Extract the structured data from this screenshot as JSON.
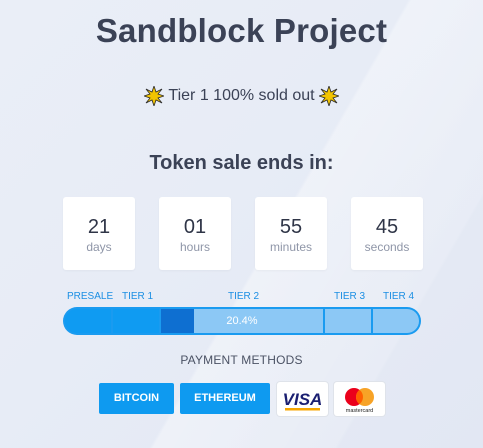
{
  "header": {
    "title": "Sandblock Project",
    "soldout_text": "Tier 1 100% sold out"
  },
  "countdown": {
    "heading": "Token sale ends in:",
    "items": [
      {
        "value": "21",
        "unit": "days"
      },
      {
        "value": "01",
        "unit": "hours"
      },
      {
        "value": "55",
        "unit": "minutes"
      },
      {
        "value": "45",
        "unit": "seconds"
      }
    ]
  },
  "progress": {
    "tiers": [
      "PRESALE",
      "TIER 1",
      "TIER 2",
      "TIER 3",
      "TIER 4"
    ],
    "tier2_label": "20.4%",
    "tier2_fraction": 0.204
  },
  "payment": {
    "heading": "PAYMENT METHODS",
    "buttons": [
      "BITCOIN",
      "ETHEREUM"
    ],
    "cards": [
      {
        "name": "VISA",
        "icon": "visa-card-icon"
      },
      {
        "name": "mastercard",
        "icon": "mastercard-icon"
      }
    ]
  },
  "colors": {
    "accent": "#0e9af0",
    "progress_dark": "#0e6fd1",
    "progress_light": "#8cc8f5",
    "title": "#3b4256"
  }
}
